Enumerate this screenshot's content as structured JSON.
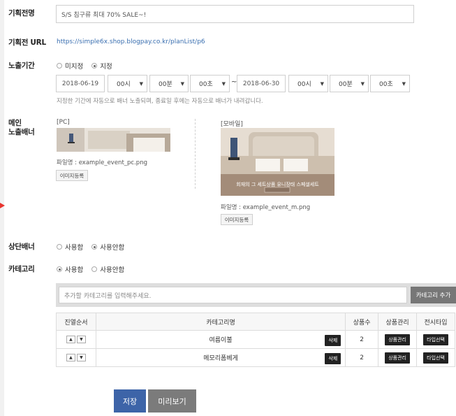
{
  "form": {
    "name_label": "기획전명",
    "name_value": "S/S 침구류 최대 70% SALE~!",
    "url_label": "기획전 URL",
    "url_value": "https://simple6x.shop.blogpay.co.kr/planList/p6",
    "period_label": "노출기간",
    "period_options": {
      "unset": "미지정",
      "set": "지정"
    },
    "period_selected": "지정",
    "start": {
      "date": "2018-06-19",
      "hour": "00시",
      "minute": "00분",
      "second": "00초"
    },
    "period_separator": "~",
    "end": {
      "date": "2018-06-30",
      "hour": "00시",
      "minute": "00분",
      "second": "00초"
    },
    "period_hint": "지정한 기간에 자동으로 배너 노출되며, 종료일 후에는 자동으로 배너가 내려갑니다.",
    "main_banner_label_line1": "메인",
    "main_banner_label_line2": "노출배너",
    "pc": {
      "caption": "[PC]",
      "filename": "파일명 : example_event_pc.png",
      "upload_label": "이미지등록"
    },
    "mobile": {
      "caption": "[모바일]",
      "banner_text": "회재의 그 세트상품 유니장태 스페셜세트",
      "filename": "파일명 : example_event_m.png",
      "upload_label": "이미지등록"
    },
    "top_banner_label": "상단배너",
    "top_banner_options": {
      "use": "사용함",
      "nouse": "사용안함"
    },
    "top_banner_selected": "사용안함",
    "category_label": "카테고리",
    "category_options": {
      "use": "사용함",
      "nouse": "사용안함"
    },
    "category_selected": "사용함",
    "category_input_placeholder": "추가할 카테고리를 입력해주세요.",
    "category_add_label": "카테고리 추가"
  },
  "table": {
    "headers": [
      "진열순서",
      "카테고리명",
      "상품수",
      "상품관리",
      "전시타입"
    ],
    "rows": [
      {
        "name": "여름이불",
        "delete": "삭제",
        "count": "2",
        "manage": "상품관리",
        "type": "타입선택"
      },
      {
        "name": "메모리폼베게",
        "delete": "삭제",
        "count": "2",
        "manage": "상품관리",
        "type": "타입선택"
      }
    ]
  },
  "actions": {
    "save": "저장",
    "preview": "미리보기"
  },
  "colors": {
    "save_bg": "#3d64a8",
    "preview_bg": "#7b7b7b",
    "arrow": "#e8352f"
  }
}
